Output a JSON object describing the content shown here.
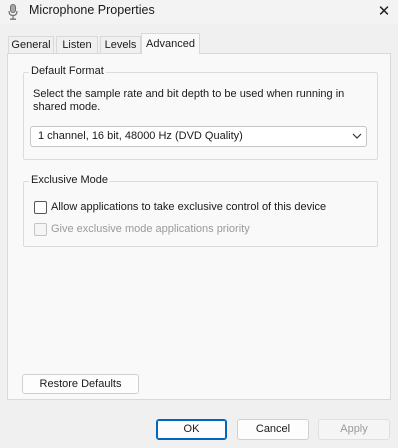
{
  "window": {
    "title": "Microphone Properties",
    "icon": "microphone-icon",
    "close_glyph": "✕"
  },
  "tabs": [
    {
      "label": "General",
      "active": false
    },
    {
      "label": "Listen",
      "active": false
    },
    {
      "label": "Levels",
      "active": false
    },
    {
      "label": "Advanced",
      "active": true
    }
  ],
  "default_format": {
    "title": "Default Format",
    "description": "Select the sample rate and bit depth to be used when running in shared mode.",
    "selected": "1 channel, 16 bit, 48000 Hz (DVD Quality)"
  },
  "exclusive_mode": {
    "title": "Exclusive Mode",
    "allow_label": "Allow applications to take exclusive control of this device",
    "allow_checked": false,
    "priority_label": "Give exclusive mode applications priority",
    "priority_checked": false,
    "priority_disabled": true
  },
  "buttons": {
    "restore_defaults": "Restore Defaults",
    "ok": "OK",
    "cancel": "Cancel",
    "apply": "Apply"
  },
  "colors": {
    "accent": "#0067c0",
    "background": "#f0f0f0",
    "panel": "#f9f9f9"
  }
}
